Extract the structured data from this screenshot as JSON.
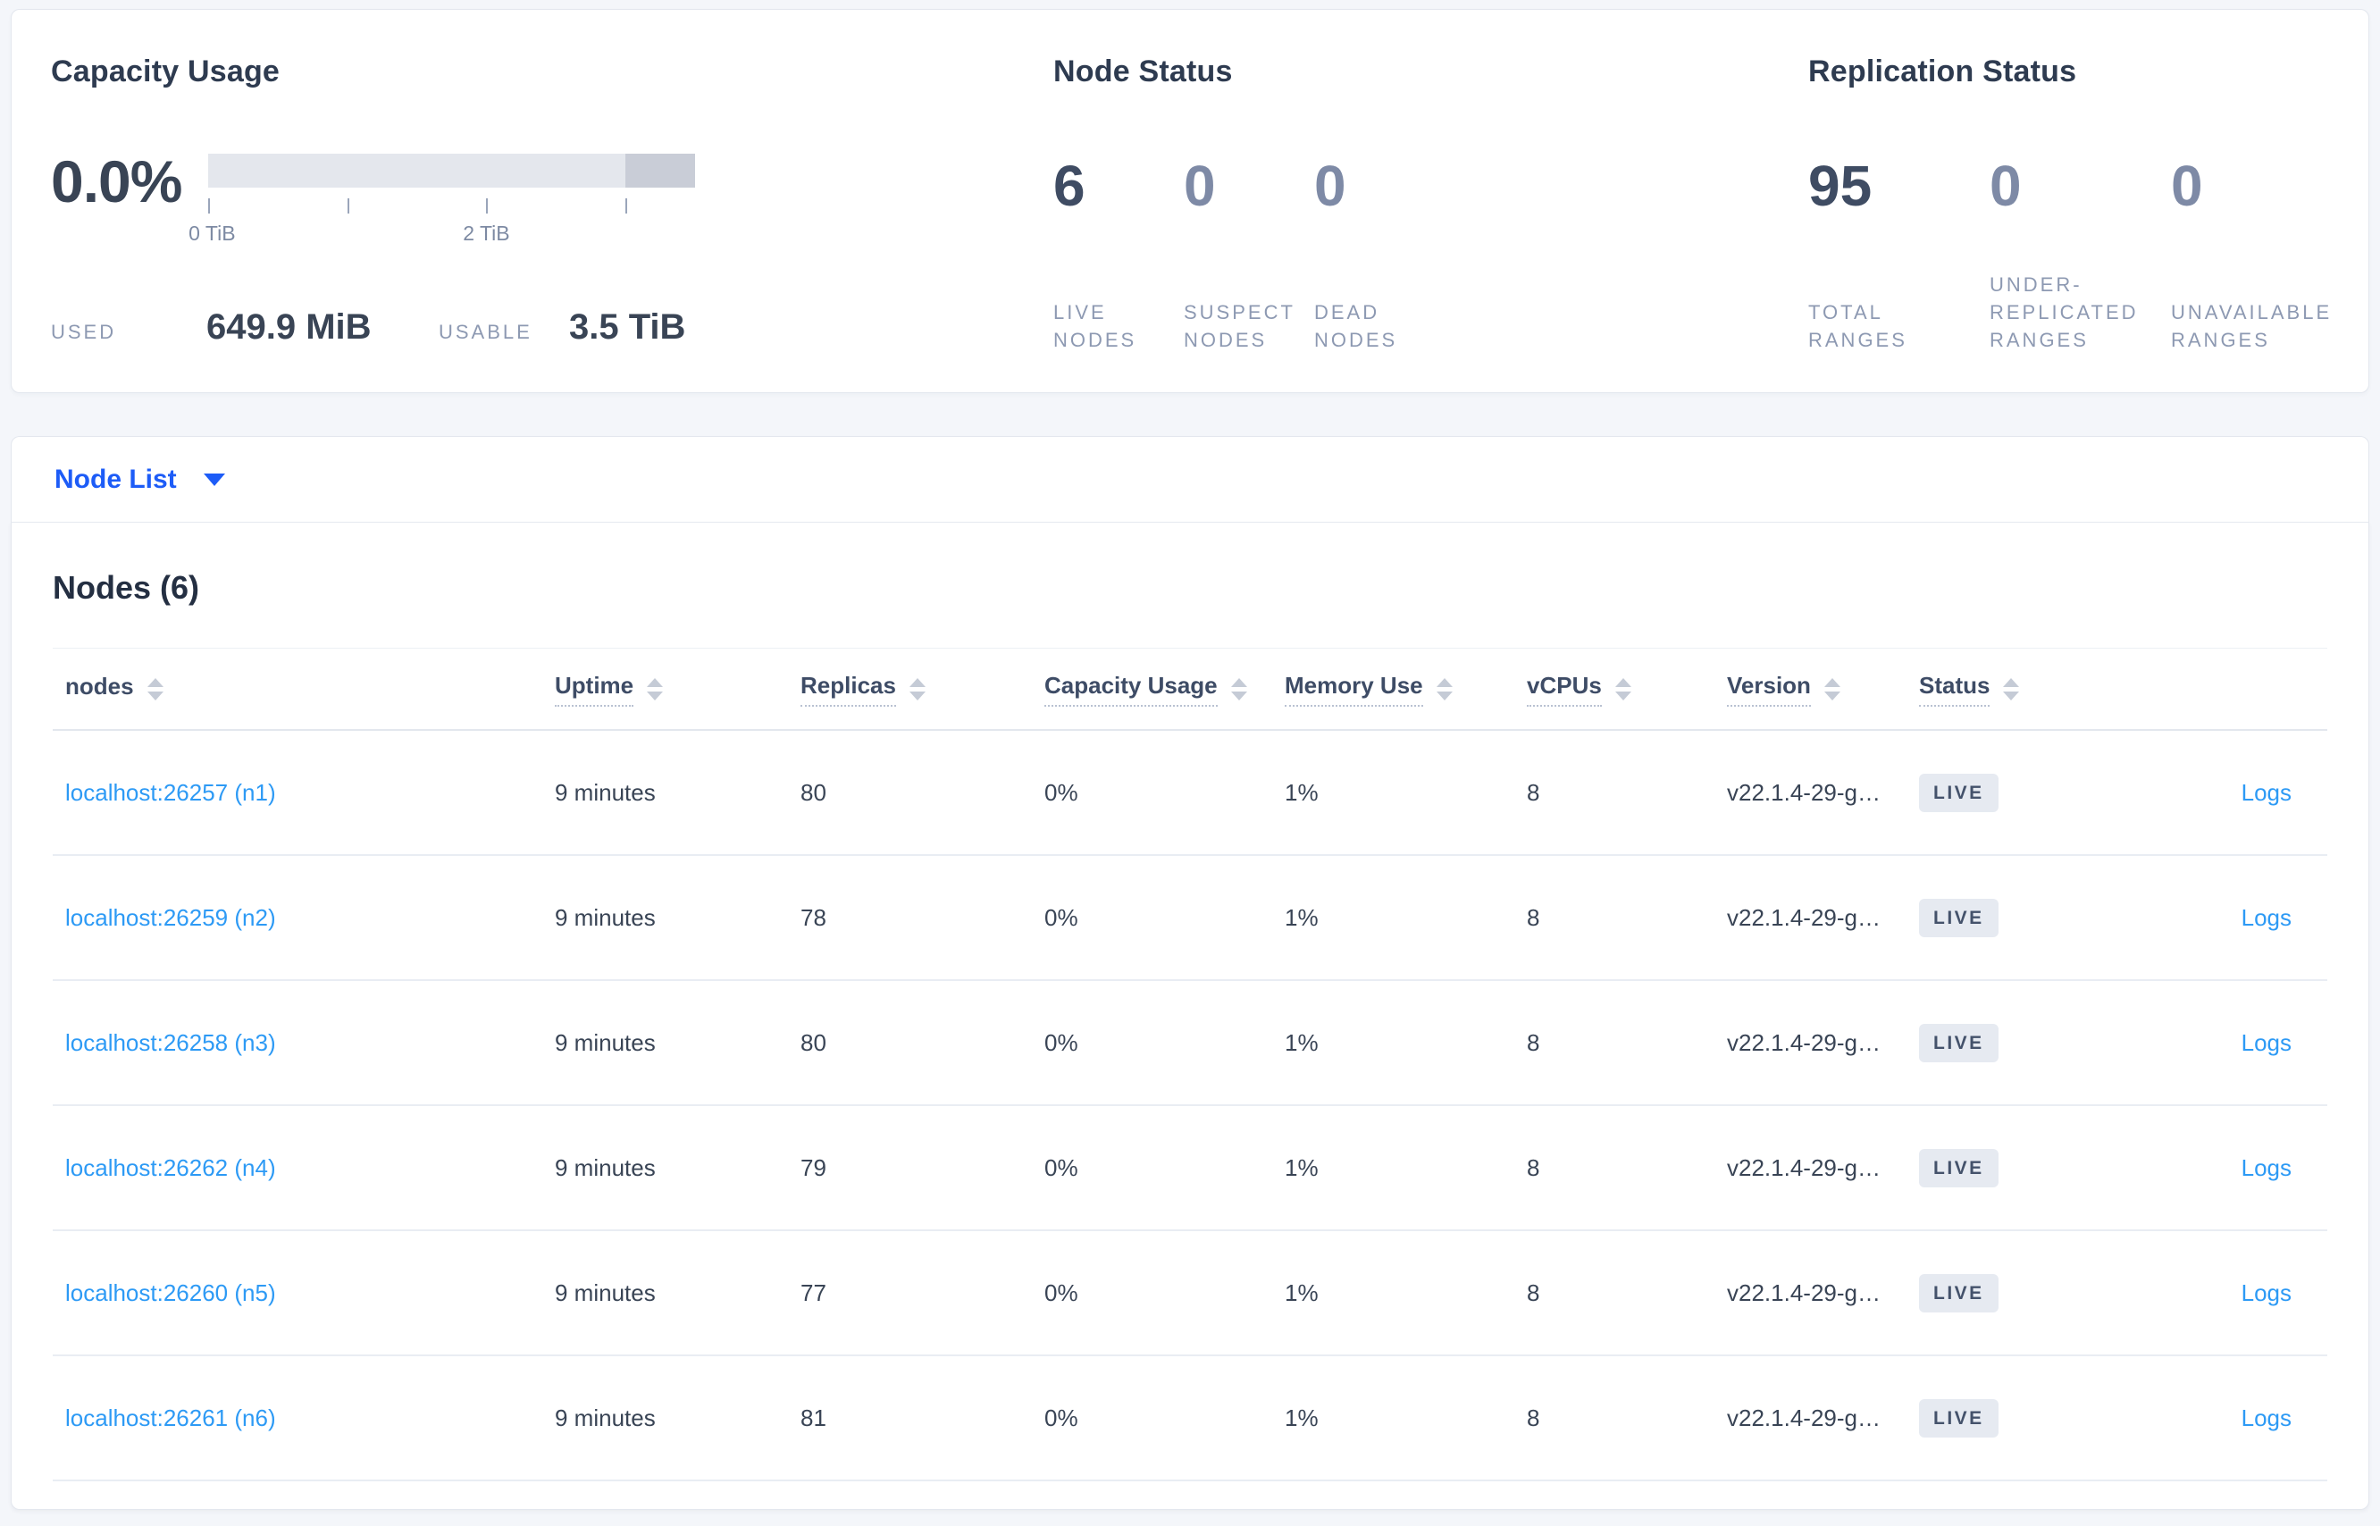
{
  "colors": {
    "accent_blue": "#1d5cf7",
    "link_blue": "#2d9af5",
    "badge_bg": "#e6eaf1",
    "bar_track": "#e4e7ed",
    "bar_unusable": "#c9cdd7"
  },
  "summary": {
    "capacity": {
      "title": "Capacity Usage",
      "percent": "0.0%",
      "tick_labels": [
        "0 TiB",
        "2 TiB"
      ],
      "used_label": "USED",
      "used_value": "649.9 MiB",
      "usable_label": "USABLE",
      "usable_value": "3.5 TiB"
    },
    "node_status": {
      "title": "Node Status",
      "stats": [
        {
          "value": "6",
          "label": "LIVE NODES"
        },
        {
          "value": "0",
          "label": "SUSPECT NODES"
        },
        {
          "value": "0",
          "label": "DEAD NODES"
        }
      ]
    },
    "replication": {
      "title": "Replication Status",
      "stats": [
        {
          "value": "95",
          "label": "TOTAL RANGES"
        },
        {
          "value": "0",
          "label": "UNDER-REPLICATED RANGES"
        },
        {
          "value": "0",
          "label": "UNAVAILABLE RANGES"
        }
      ]
    }
  },
  "view_selector": {
    "label": "Node List"
  },
  "table": {
    "title": "Nodes (6)",
    "columns": [
      {
        "label": "nodes"
      },
      {
        "label": "Uptime"
      },
      {
        "label": "Replicas"
      },
      {
        "label": "Capacity Usage"
      },
      {
        "label": "Memory Use"
      },
      {
        "label": "vCPUs"
      },
      {
        "label": "Version"
      },
      {
        "label": "Status"
      }
    ],
    "rows": [
      {
        "node": "localhost:26257 (n1)",
        "uptime": "9 minutes",
        "replicas": "80",
        "capacity": "0%",
        "memory": "1%",
        "vcpus": "8",
        "version": "v22.1.4-29-g…",
        "status": "LIVE",
        "logs_label": "Logs"
      },
      {
        "node": "localhost:26259 (n2)",
        "uptime": "9 minutes",
        "replicas": "78",
        "capacity": "0%",
        "memory": "1%",
        "vcpus": "8",
        "version": "v22.1.4-29-g…",
        "status": "LIVE",
        "logs_label": "Logs"
      },
      {
        "node": "localhost:26258 (n3)",
        "uptime": "9 minutes",
        "replicas": "80",
        "capacity": "0%",
        "memory": "1%",
        "vcpus": "8",
        "version": "v22.1.4-29-g…",
        "status": "LIVE",
        "logs_label": "Logs"
      },
      {
        "node": "localhost:26262 (n4)",
        "uptime": "9 minutes",
        "replicas": "79",
        "capacity": "0%",
        "memory": "1%",
        "vcpus": "8",
        "version": "v22.1.4-29-g…",
        "status": "LIVE",
        "logs_label": "Logs"
      },
      {
        "node": "localhost:26260 (n5)",
        "uptime": "9 minutes",
        "replicas": "77",
        "capacity": "0%",
        "memory": "1%",
        "vcpus": "8",
        "version": "v22.1.4-29-g…",
        "status": "LIVE",
        "logs_label": "Logs"
      },
      {
        "node": "localhost:26261 (n6)",
        "uptime": "9 minutes",
        "replicas": "81",
        "capacity": "0%",
        "memory": "1%",
        "vcpus": "8",
        "version": "v22.1.4-29-g…",
        "status": "LIVE",
        "logs_label": "Logs"
      }
    ]
  }
}
